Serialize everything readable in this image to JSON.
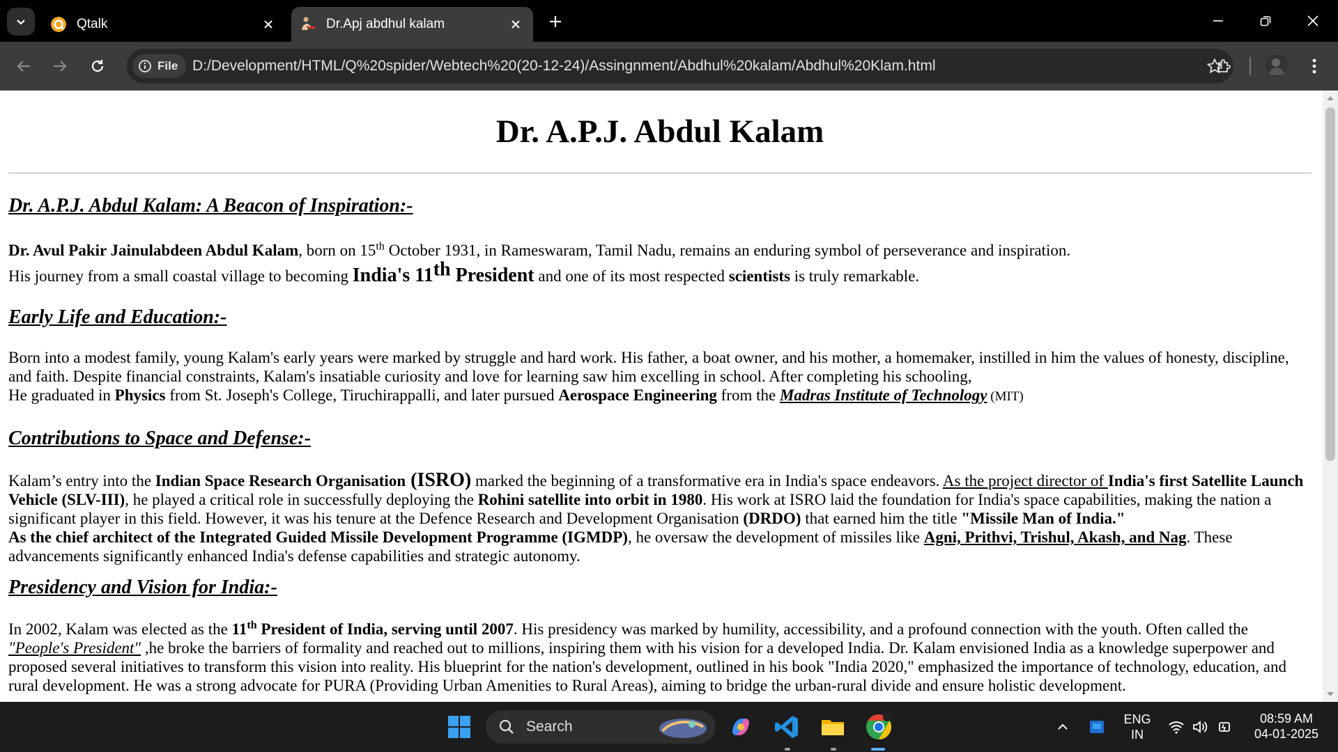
{
  "browser": {
    "tabs": [
      {
        "title": "Qtalk",
        "active": false
      },
      {
        "title": "Dr.Apj abdhul kalam",
        "active": true
      }
    ],
    "address_chip": "File",
    "url": "D:/Development/HTML/Q%20spider/Webtech%20(20-12-24)/Assingnment/Abdhul%20kalam/Abdhul%20Klam.html"
  },
  "page": {
    "title": "Dr. A.P.J. Abdul Kalam",
    "s1": {
      "heading": "Dr. A.P.J. Abdul Kalam: A Beacon of Inspiration:-",
      "l1_name": "Dr. Avul Pakir Jainulabdeen Abdul Kalam",
      "l1_a": ", born on 15",
      "l1_sup": "th",
      "l1_b": " October 1931, in Rameswaram, Tamil Nadu, remains an enduring symbol of perseverance and inspiration.",
      "l2_a": "His journey from a small coastal village to becoming ",
      "l2_big": "India's 11",
      "l2_sup": "th",
      "l2_big2": " President",
      "l2_b": " and one of its most respected ",
      "l2_bold": "scientists",
      "l2_c": " is truly remarkable."
    },
    "s2": {
      "heading": "Early Life and Education:-",
      "p1": "Born into a modest family, young Kalam's early years were marked by struggle and hard work. His father, a boat owner, and his mother, a homemaker, instilled in him the values of honesty, discipline, and faith. Despite financial constraints, Kalam's insatiable curiosity and love for learning saw him excelling in school. After completing his schooling,",
      "p2_a": "He graduated in ",
      "p2_physics": "Physics",
      "p2_b": " from St. Joseph's College, Tiruchirappalli, and later pursued ",
      "p2_aero": "Aerospace Engineering",
      "p2_c": " from the ",
      "p2_mit": "Madras Institute of Technology",
      "p2_mit_abbr": " (MIT)"
    },
    "s3": {
      "heading": "Contributions to Space and Defense:-",
      "a": "Kalam’s entry into the ",
      "isro_name": "Indian Space Research Organisation",
      "isro_abbr": " (ISRO)",
      "b": " marked the beginning of a transformative era in India's space endeavors. ",
      "c_u": "As the project director of ",
      "slv": "India's first Satellite Launch Vehicle (SLV-III)",
      "d": ", he played a critical role in successfully deploying the ",
      "rohini": "Rohini satellite into orbit in 1980",
      "e": ". His work at ISRO laid the foundation for India's space capabilities, making the nation a significant player in this field. However, it was his tenure at the Defence Research and Development Organisation ",
      "drdo": "(DRDO)",
      "f": " that earned him the title ",
      "missile": "\"Missile Man of India.\"",
      "igmdp": "As the chief architect of the Integrated Guided Missile Development Programme (IGMDP)",
      "g": ", he oversaw the development of missiles like ",
      "missiles": "Agni, Prithvi, Trishul, Akash, and Nag",
      "h": ". These advancements significantly enhanced India's defense capabilities and strategic autonomy."
    },
    "s4": {
      "heading": "Presidency and Vision for India:-",
      "a": "In 2002, Kalam was elected as the ",
      "b1": "11",
      "sup": "th",
      "b2": " President of India, serving until 2007",
      "c": ". His presidency was marked by humility, accessibility, and a profound connection with the youth. Often called the ",
      "peoples": "\"People's President\"",
      "d": " ,he broke the barriers of formality and reached out to millions, inspiring them with his vision for a developed India. Dr. Kalam envisioned India as a knowledge superpower and proposed several initiatives to transform this vision into reality. His blueprint for the nation's development, outlined in his book \"India 2020,\" emphasized the importance of technology, education, and rural development. He was a strong advocate for PURA (Providing Urban Amenities to Rural Areas), aiming to bridge the urban-rural divide and ensure holistic development."
    }
  },
  "taskbar": {
    "search_label": "Search",
    "lang_top": "ENG",
    "lang_bottom": "IN",
    "time": "08:59 AM",
    "date": "04-01-2025"
  }
}
